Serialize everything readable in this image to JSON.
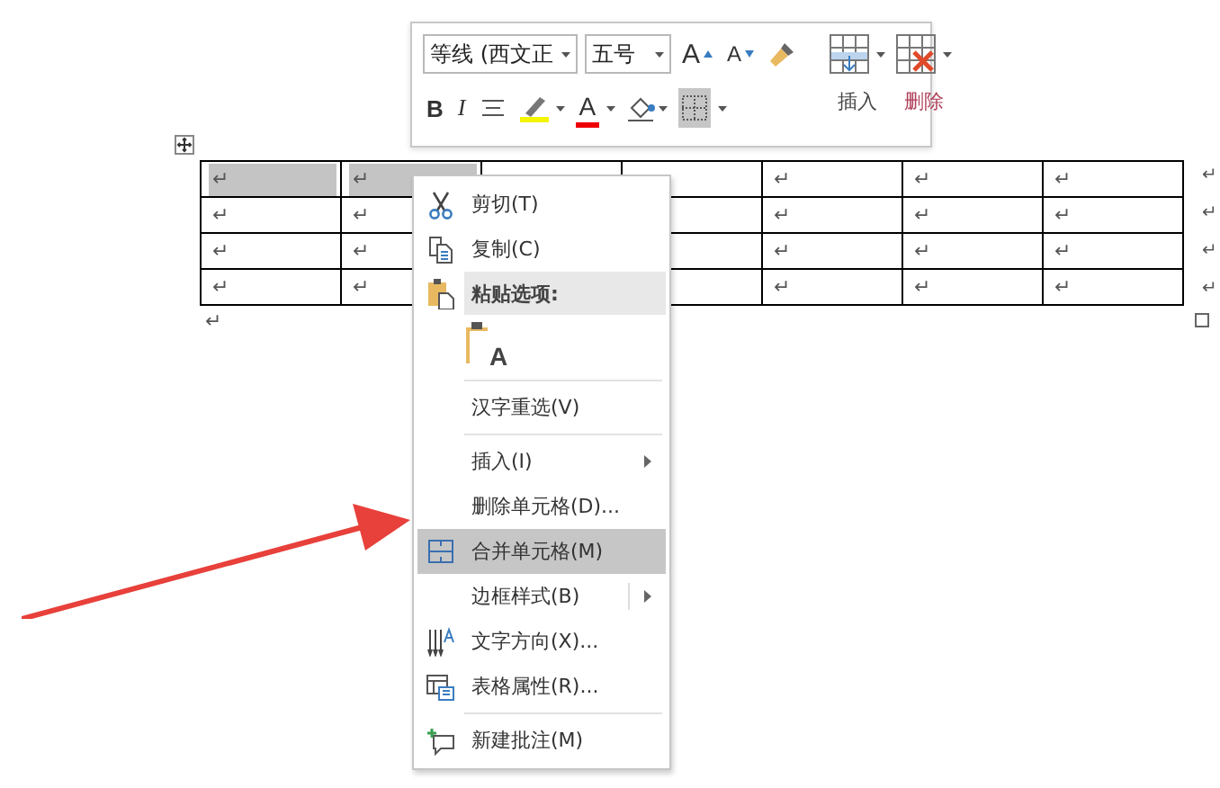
{
  "mini_toolbar": {
    "font": "等线 (西文正",
    "size": "五号",
    "grow_font": "A",
    "shrink_font": "A",
    "bold": "B",
    "italic": "I",
    "font_color": "A",
    "borders_selected": true,
    "insert_label": "插入",
    "delete_label": "删除"
  },
  "table": {
    "rows": [
      [
        {
          "text": "↵",
          "selected": true
        },
        {
          "text": "↵",
          "selected": true
        },
        null,
        null,
        {
          "text": "↵",
          "selected": false
        },
        {
          "text": "↵",
          "selected": false
        },
        {
          "text": "↵",
          "selected": false
        }
      ],
      [
        {
          "text": "↵",
          "selected": false
        },
        {
          "text": "↵",
          "selected": false
        },
        null,
        null,
        {
          "text": "↵",
          "selected": false
        },
        {
          "text": "↵",
          "selected": false
        },
        {
          "text": "↵",
          "selected": false
        }
      ],
      [
        {
          "text": "↵",
          "selected": false
        },
        {
          "text": "↵",
          "selected": false
        },
        null,
        null,
        {
          "text": "↵",
          "selected": false
        },
        {
          "text": "↵",
          "selected": false
        },
        {
          "text": "↵",
          "selected": false
        }
      ],
      [
        {
          "text": "↵",
          "selected": false
        },
        {
          "text": "↵",
          "selected": false
        },
        null,
        null,
        {
          "text": "↵",
          "selected": false
        },
        {
          "text": "↵",
          "selected": false
        },
        {
          "text": "↵",
          "selected": false
        }
      ]
    ],
    "row_marks": [
      "↵",
      "↵",
      "↵",
      "↵"
    ]
  },
  "paragraph_mark": "↵",
  "context_menu": [
    {
      "kind": "item",
      "label": "剪切(T)",
      "selected": false
    },
    {
      "kind": "item",
      "label": "复制(C)",
      "selected": false
    },
    {
      "kind": "header",
      "label": "粘贴选项:"
    },
    {
      "kind": "paste-option",
      "label": "A"
    },
    {
      "kind": "separator"
    },
    {
      "kind": "item",
      "label": "汉字重选(V)",
      "selected": false
    },
    {
      "kind": "separator"
    },
    {
      "kind": "item",
      "label": "插入(I)",
      "submenu": true,
      "selected": false
    },
    {
      "kind": "item",
      "label": "删除单元格(D)...",
      "selected": false
    },
    {
      "kind": "item",
      "label": "合并单元格(M)",
      "selected": true
    },
    {
      "kind": "item",
      "label": "边框样式(B)",
      "submenu": true,
      "split": true,
      "selected": false
    },
    {
      "kind": "item",
      "label": "文字方向(X)...",
      "selected": false
    },
    {
      "kind": "item",
      "label": "表格属性(R)...",
      "selected": false
    },
    {
      "kind": "separator"
    },
    {
      "kind": "item",
      "label": "新建批注(M)",
      "selected": false
    }
  ]
}
